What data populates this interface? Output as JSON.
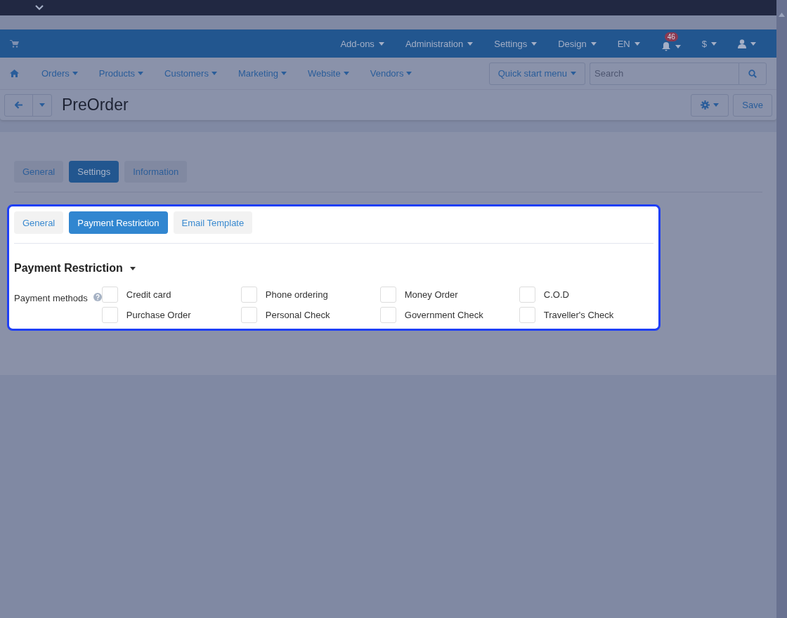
{
  "header": {
    "menus": [
      {
        "kind": "text",
        "label": "Add-ons"
      },
      {
        "kind": "text",
        "label": "Administration"
      },
      {
        "kind": "text",
        "label": "Settings"
      },
      {
        "kind": "text",
        "label": "Design"
      },
      {
        "kind": "text",
        "label": "EN"
      },
      {
        "kind": "bell",
        "badge": "46"
      },
      {
        "kind": "text",
        "label": "$"
      },
      {
        "kind": "user"
      }
    ]
  },
  "nav": {
    "items": [
      "Orders",
      "Products",
      "Customers",
      "Marketing",
      "Website",
      "Vendors"
    ],
    "quick_start": "Quick start menu",
    "search": {
      "placeholder": "Search"
    }
  },
  "title_bar": {
    "title": "PreOrder",
    "save": "Save"
  },
  "outer_tabs": [
    {
      "label": "General",
      "selected": false
    },
    {
      "label": "Settings",
      "selected": true
    },
    {
      "label": "Information",
      "selected": false
    }
  ],
  "panel": {
    "tabs": [
      {
        "label": "General",
        "selected": false
      },
      {
        "label": "Payment Restriction",
        "selected": true
      },
      {
        "label": "Email Template",
        "selected": false
      }
    ],
    "section": "Payment Restriction",
    "field_label": "Payment methods",
    "options": [
      {
        "label": "Credit card",
        "checked": false
      },
      {
        "label": "Phone ordering",
        "checked": false
      },
      {
        "label": "Money Order",
        "checked": false
      },
      {
        "label": "C.O.D",
        "checked": false
      },
      {
        "label": "Purchase Order",
        "checked": false
      },
      {
        "label": "Personal Check",
        "checked": false
      },
      {
        "label": "Government Check",
        "checked": false
      },
      {
        "label": "Traveller's Check",
        "checked": false
      }
    ]
  }
}
